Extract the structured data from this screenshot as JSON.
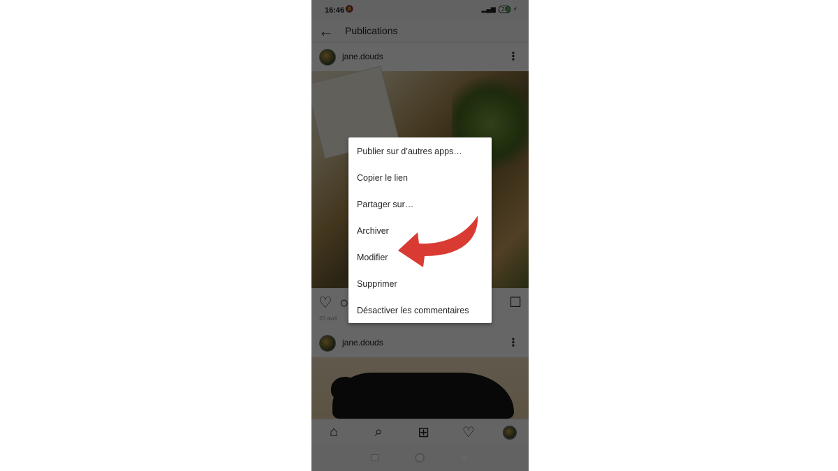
{
  "status_bar": {
    "time": "16:46",
    "battery": "28",
    "bell_icon": "bell-off-icon",
    "signal_icon": "signal-icon",
    "charging_icon": "bolt-icon"
  },
  "app_bar": {
    "title": "Publications",
    "back_icon": "arrow-left-icon"
  },
  "posts": [
    {
      "username": "jane.douds",
      "date": "20 avril"
    },
    {
      "username": "jane.douds"
    }
  ],
  "context_menu": {
    "items": [
      "Publier sur d’autres apps…",
      "Copier le lien",
      "Partager sur…",
      "Archiver",
      "Modifier",
      "Supprimer",
      "Désactiver les commentaires"
    ],
    "highlighted": "Modifier"
  },
  "annotation": {
    "color": "#d93a32",
    "points_to": "Modifier"
  },
  "icons": {
    "back": "←",
    "more": "⋮",
    "heart": "♡",
    "comment": "○",
    "bookmark": "☐",
    "home": "⌂",
    "search": "⌕",
    "add": "⊞",
    "activity": "♡",
    "bell": "⍾"
  }
}
